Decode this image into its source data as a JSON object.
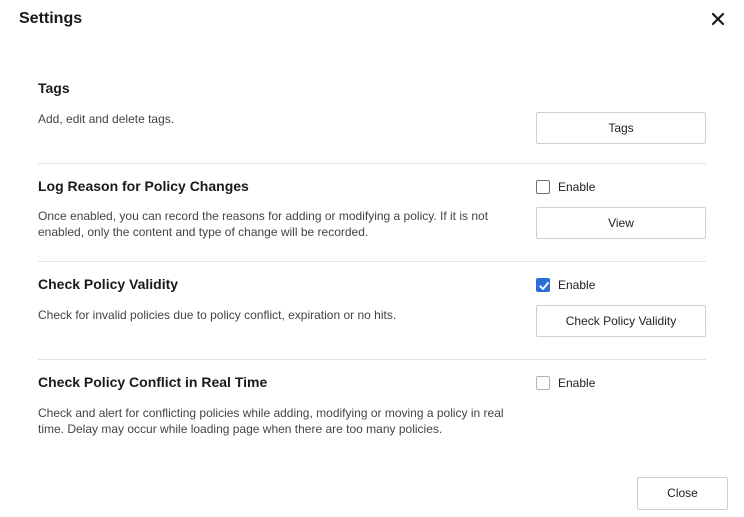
{
  "dialog": {
    "title": "Settings",
    "close_icon": "close-icon",
    "close_button_label": "Close"
  },
  "sections": [
    {
      "title": "Tags",
      "description": "Add, edit and delete tags.",
      "button_label": "Tags"
    },
    {
      "title": "Log Reason for Policy Changes",
      "description": "Once enabled, you can record the reasons for adding or modifying a policy. If it is not enabled, only the content and type of change will be recorded.",
      "toggle_label": "Enable",
      "enabled": false,
      "button_label": "View"
    },
    {
      "title": "Check Policy Validity",
      "description": "Check for invalid policies due to policy conflict, expiration or no hits.",
      "toggle_label": "Enable",
      "enabled": true,
      "button_label": "Check Policy Validity"
    },
    {
      "title": "Check Policy Conflict in Real Time",
      "description": "Check and alert for conflicting policies while adding, modifying or moving a policy in real time. Delay may occur while loading page when there are too many policies.",
      "toggle_label": "Enable",
      "enabled": false
    }
  ],
  "colors": {
    "accent": "#2a6fd6",
    "divider": "#e3e3e3",
    "button_border": "#cfcfcf"
  }
}
